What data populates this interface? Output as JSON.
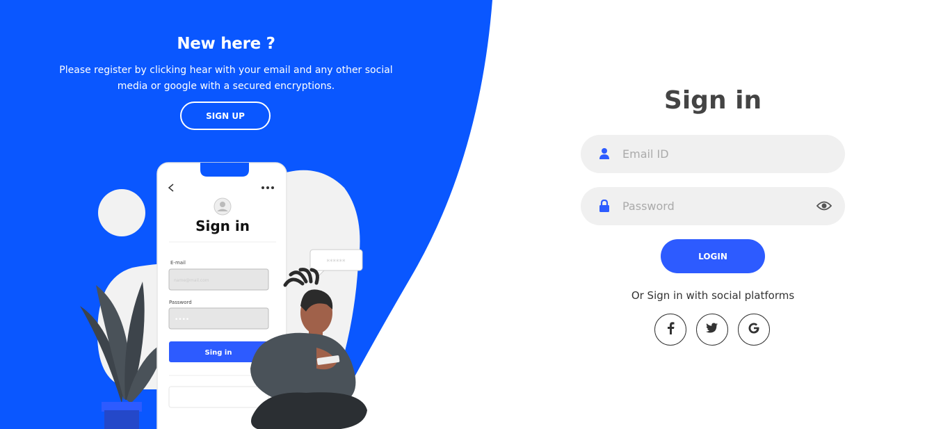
{
  "left": {
    "title": "New here ?",
    "text": "Please register by clicking hear with your email and any other social media or google with a secured encryptions.",
    "signup_label": "SIGN UP"
  },
  "illustration": {
    "phone_title": "Sign in",
    "email_label": "E-mail",
    "email_placeholder": "name@mail.com",
    "password_label": "Password",
    "password_value": "••••",
    "button_label": "Sing in",
    "bubble_text": "******",
    "colors": {
      "accent": "#2d5bff",
      "skin": "#a0614a",
      "shirt": "#4a5259",
      "leaf": "#3d444b"
    }
  },
  "signin": {
    "title": "Sign in",
    "email_placeholder": "Email ID",
    "password_placeholder": "Password",
    "login_label": "LOGIN",
    "social_text": "Or Sign in with social platforms",
    "social": [
      {
        "icon": "facebook-icon",
        "label": "f"
      },
      {
        "icon": "twitter-icon",
        "label": "twitter"
      },
      {
        "icon": "google-icon",
        "label": "G"
      }
    ]
  },
  "colors": {
    "brand_blue": "#0a57ff",
    "button_blue": "#2d5bff",
    "field_bg": "#f0f0f0",
    "title": "#444444"
  }
}
